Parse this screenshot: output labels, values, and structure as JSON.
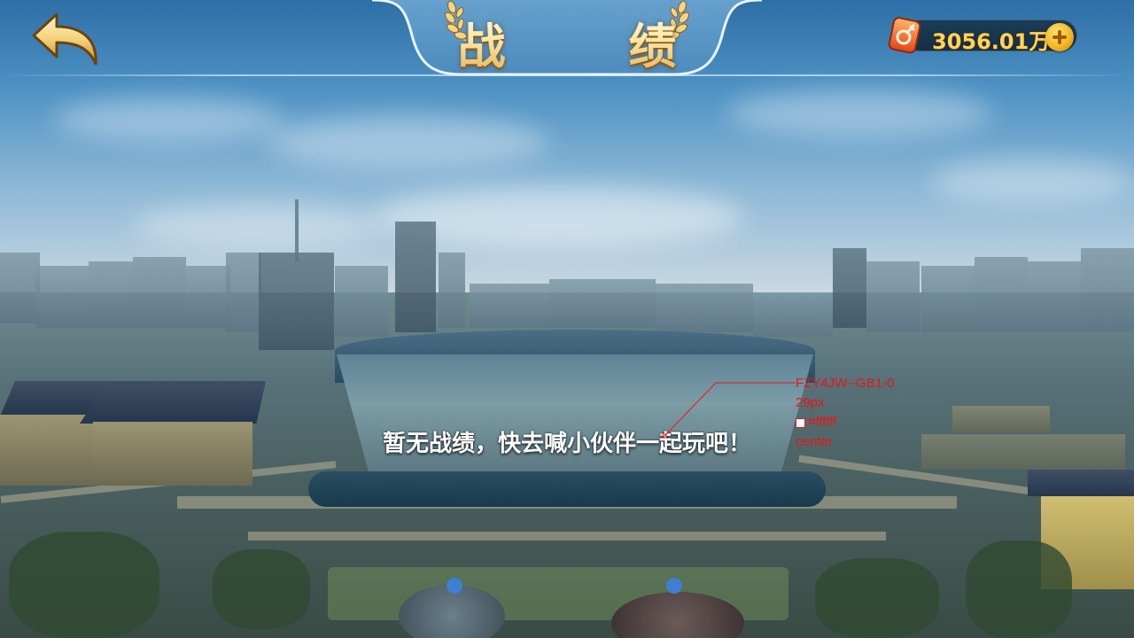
{
  "header": {
    "title": "战  绩",
    "back_icon": "back-arrow-icon",
    "laurel_icon": "laurel-icon"
  },
  "wallet": {
    "icon": "coin-ticket-icon",
    "amount": "3056.01万",
    "add_icon": "plus-icon"
  },
  "main": {
    "empty_message": "暂无战绩，快去喊小伙伴一起玩吧！"
  },
  "annotation": {
    "font": "FZY4JW--GB1-0",
    "size": "29px",
    "color": "#ffffff",
    "align": "center"
  },
  "colors": {
    "title_gold": "#ffe8a4",
    "coin_text": "#ffd45a",
    "annotation_red": "#e8151a",
    "message_text": "#ffffff"
  }
}
